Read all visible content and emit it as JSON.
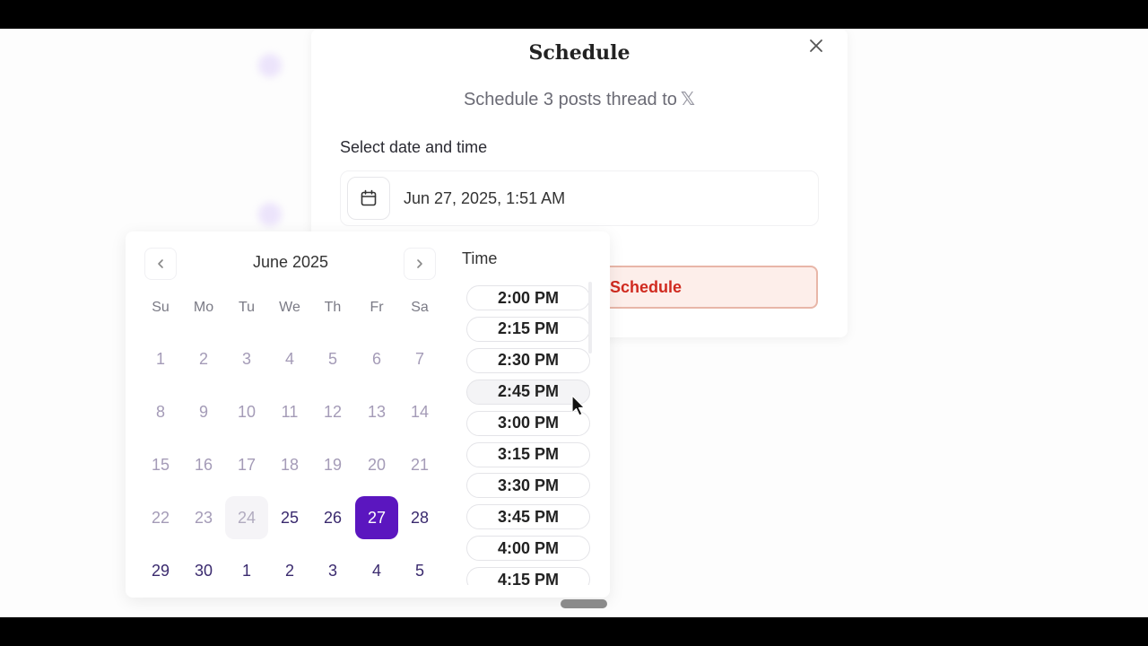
{
  "modal": {
    "title": "Schedule",
    "subtitle": "Schedule 3 posts thread to",
    "platform_glyph": "𝕏",
    "field_label": "Select date and time",
    "date_value": "Jun 27, 2025, 1:51 AM",
    "schedule_button_label": "Schedule",
    "close_icon": "close-icon",
    "calendar_icon": "calendar-icon"
  },
  "calendar": {
    "month_label": "June 2025",
    "prev_icon": "chevron-left-icon",
    "next_icon": "chevron-right-icon",
    "weekdays": [
      "Su",
      "Mo",
      "Tu",
      "We",
      "Th",
      "Fr",
      "Sa"
    ],
    "weeks": [
      [
        {
          "d": "1",
          "s": "past"
        },
        {
          "d": "2",
          "s": "past"
        },
        {
          "d": "3",
          "s": "past"
        },
        {
          "d": "4",
          "s": "past"
        },
        {
          "d": "5",
          "s": "past"
        },
        {
          "d": "6",
          "s": "past"
        },
        {
          "d": "7",
          "s": "past"
        }
      ],
      [
        {
          "d": "8",
          "s": "past"
        },
        {
          "d": "9",
          "s": "past"
        },
        {
          "d": "10",
          "s": "past"
        },
        {
          "d": "11",
          "s": "past"
        },
        {
          "d": "12",
          "s": "past"
        },
        {
          "d": "13",
          "s": "past"
        },
        {
          "d": "14",
          "s": "past"
        }
      ],
      [
        {
          "d": "15",
          "s": "past"
        },
        {
          "d": "16",
          "s": "past"
        },
        {
          "d": "17",
          "s": "past"
        },
        {
          "d": "18",
          "s": "past"
        },
        {
          "d": "19",
          "s": "past"
        },
        {
          "d": "20",
          "s": "past"
        },
        {
          "d": "21",
          "s": "past"
        }
      ],
      [
        {
          "d": "22",
          "s": "past"
        },
        {
          "d": "23",
          "s": "past"
        },
        {
          "d": "24",
          "s": "today"
        },
        {
          "d": "25",
          "s": "active"
        },
        {
          "d": "26",
          "s": "active"
        },
        {
          "d": "27",
          "s": "selected"
        },
        {
          "d": "28",
          "s": "active"
        }
      ],
      [
        {
          "d": "29",
          "s": "active"
        },
        {
          "d": "30",
          "s": "active"
        },
        {
          "d": "1",
          "s": "active"
        },
        {
          "d": "2",
          "s": "active"
        },
        {
          "d": "3",
          "s": "active"
        },
        {
          "d": "4",
          "s": "active"
        },
        {
          "d": "5",
          "s": "active"
        }
      ]
    ],
    "selected_color": "#5b16bf"
  },
  "time": {
    "title": "Time",
    "slots": [
      "2:00 PM",
      "2:15 PM",
      "2:30 PM",
      "2:45 PM",
      "3:00 PM",
      "3:15 PM",
      "3:30 PM",
      "3:45 PM",
      "4:00 PM",
      "4:15 PM"
    ],
    "hovered": "2:45 PM"
  }
}
